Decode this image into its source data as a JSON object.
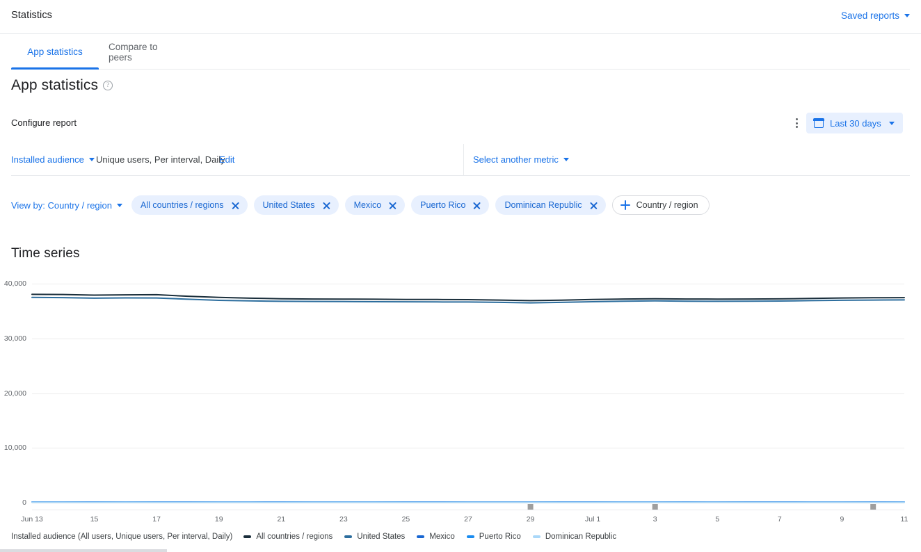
{
  "topbar": {
    "title": "Statistics",
    "saved_reports_label": "Saved reports"
  },
  "tabs": [
    {
      "label": "App statistics",
      "active": true
    },
    {
      "label": "Compare to peers",
      "active": false
    }
  ],
  "heading": {
    "title": "App statistics",
    "help_icon": "help-icon"
  },
  "configure": {
    "label": "Configure report",
    "more_icon": "more-vert-icon",
    "date_range": {
      "label": "Last 30 days",
      "calendar_icon": "calendar-icon",
      "background": "#e8f0fe",
      "text_color": "#1a73e8"
    }
  },
  "metric_row": {
    "dimension_label": "Installed audience",
    "description": "Unique users, Per interval, Daily",
    "edit_label": "Edit",
    "select_metric_label": "Select another metric"
  },
  "filters": {
    "view_by_label": "View by: Country / region",
    "chips": [
      {
        "label": "All countries / regions",
        "removable": true
      },
      {
        "label": "United States",
        "removable": true
      },
      {
        "label": "Mexico",
        "removable": true
      },
      {
        "label": "Puerto Rico",
        "removable": true
      },
      {
        "label": "Dominican Republic",
        "removable": true
      }
    ],
    "add_chip_label": "Country / region"
  },
  "chart_section": {
    "title": "Time series",
    "caption": "Installed audience (All users, Unique users, Per interval, Daily)"
  },
  "chart_data": {
    "type": "line",
    "title": "Time series",
    "xlabel": "",
    "ylabel": "",
    "ylim": [
      0,
      40000
    ],
    "yticks": [
      0,
      10000,
      20000,
      30000,
      40000
    ],
    "ytick_labels": [
      "0",
      "10,000",
      "20,000",
      "30,000",
      "40,000"
    ],
    "grid": true,
    "legend_position": "bottom",
    "x": [
      "Jun 13",
      "Jun 14",
      "Jun 15",
      "Jun 16",
      "Jun 17",
      "Jun 18",
      "Jun 19",
      "Jun 20",
      "Jun 21",
      "Jun 22",
      "Jun 23",
      "Jun 24",
      "Jun 25",
      "Jun 26",
      "Jun 27",
      "Jun 28",
      "Jun 29",
      "Jun 30",
      "Jul 1",
      "Jul 2",
      "Jul 3",
      "Jul 4",
      "Jul 5",
      "Jul 6",
      "Jul 7",
      "Jul 8",
      "Jul 9",
      "Jul 10",
      "Jul 11"
    ],
    "xtick_labels": [
      "Jun 13",
      "15",
      "17",
      "19",
      "21",
      "23",
      "25",
      "27",
      "29",
      "Jul 1",
      "3",
      "5",
      "7",
      "9",
      "11"
    ],
    "series": [
      {
        "name": "All countries / regions",
        "color": "#1a2e3b",
        "values": [
          38050,
          38020,
          37900,
          37950,
          37980,
          37700,
          37500,
          37350,
          37250,
          37200,
          37180,
          37150,
          37120,
          37100,
          37080,
          37000,
          36900,
          36980,
          37100,
          37200,
          37250,
          37200,
          37180,
          37200,
          37220,
          37300,
          37380,
          37420,
          37450
        ]
      },
      {
        "name": "United States",
        "color": "#2d6e9e",
        "values": [
          37500,
          37450,
          37350,
          37400,
          37380,
          37150,
          36950,
          36850,
          36780,
          36750,
          36720,
          36700,
          36680,
          36660,
          36650,
          36580,
          36500,
          36580,
          36700,
          36800,
          36850,
          36800,
          36780,
          36800,
          36820,
          36900,
          36960,
          37000,
          37030
        ]
      },
      {
        "name": "Mexico",
        "color": "#1967d2",
        "values": [
          120,
          118,
          122,
          119,
          125,
          121,
          117,
          120,
          123,
          119,
          118,
          120,
          122,
          121,
          119,
          118,
          120,
          121,
          123,
          120,
          119,
          121,
          120,
          122,
          121,
          120,
          119,
          121,
          120
        ]
      },
      {
        "name": "Puerto Rico",
        "color": "#1a8cf0",
        "values": [
          95,
          93,
          96,
          94,
          97,
          95,
          92,
          94,
          96,
          93,
          92,
          94,
          95,
          94,
          93,
          92,
          94,
          95,
          96,
          94,
          93,
          95,
          94,
          96,
          95,
          94,
          93,
          95,
          94
        ]
      },
      {
        "name": "Dominican Republic",
        "color": "#aad8f9",
        "values": [
          60,
          58,
          61,
          59,
          62,
          60,
          58,
          59,
          61,
          59,
          58,
          59,
          60,
          59,
          58,
          58,
          59,
          60,
          61,
          59,
          58,
          60,
          59,
          61,
          60,
          59,
          58,
          60,
          59
        ]
      }
    ],
    "markers": [
      {
        "x_index": 16,
        "color": "#9e9e9e"
      },
      {
        "x_index": 20,
        "color": "#9e9e9e"
      },
      {
        "x_index": 27,
        "color": "#9e9e9e"
      }
    ]
  }
}
